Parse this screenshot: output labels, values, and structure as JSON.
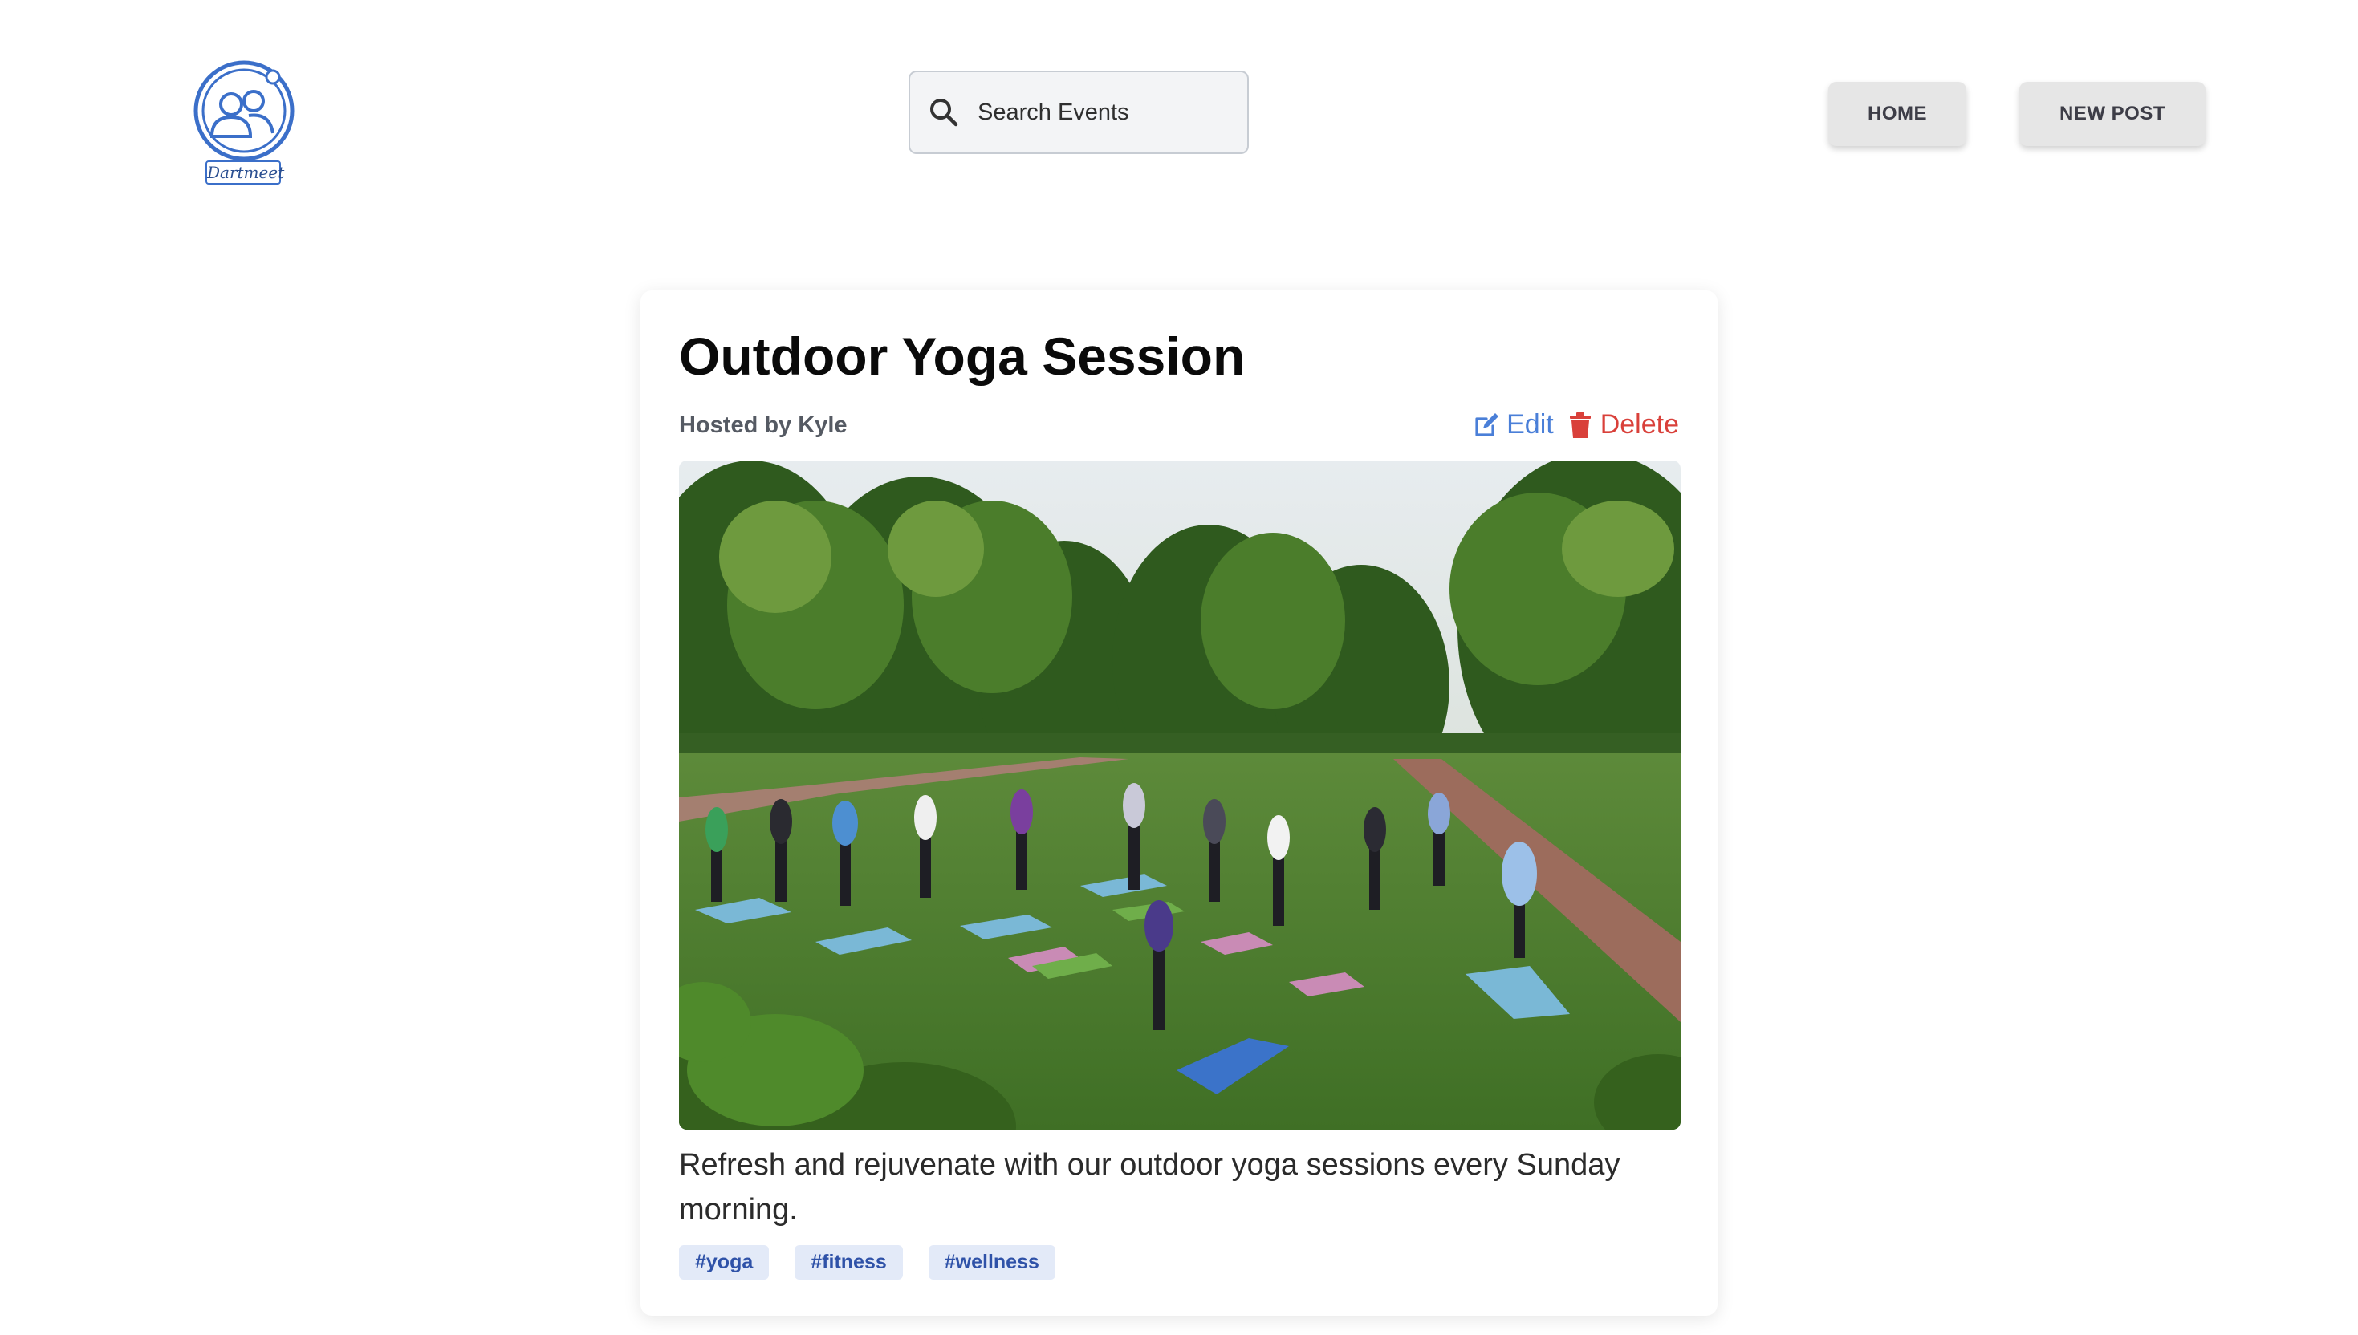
{
  "header": {
    "logo_text": "Dartmeet",
    "search": {
      "placeholder": "Search Events"
    },
    "nav": {
      "home_label": "HOME",
      "new_post_label": "NEW POST"
    }
  },
  "event": {
    "title": "Outdoor Yoga Session",
    "host": "Hosted by Kyle",
    "actions": {
      "edit_label": "Edit",
      "delete_label": "Delete"
    },
    "image_alt": "Outdoor Yoga Session",
    "description": "Refresh and rejuvenate with our outdoor yoga sessions every Sunday morning.",
    "tags": [
      "#yoga",
      "#fitness",
      "#wellness"
    ]
  },
  "colors": {
    "accent_blue": "#4a7fd8",
    "delete_red": "#d9403a",
    "tag_bg": "#e3eaf8",
    "tag_text": "#2f52a8",
    "nav_button_bg": "#e6e6e6"
  },
  "icons": {
    "logo": "people-group-icon",
    "search": "search-icon",
    "edit": "pen-to-square-icon",
    "delete": "trash-icon"
  }
}
